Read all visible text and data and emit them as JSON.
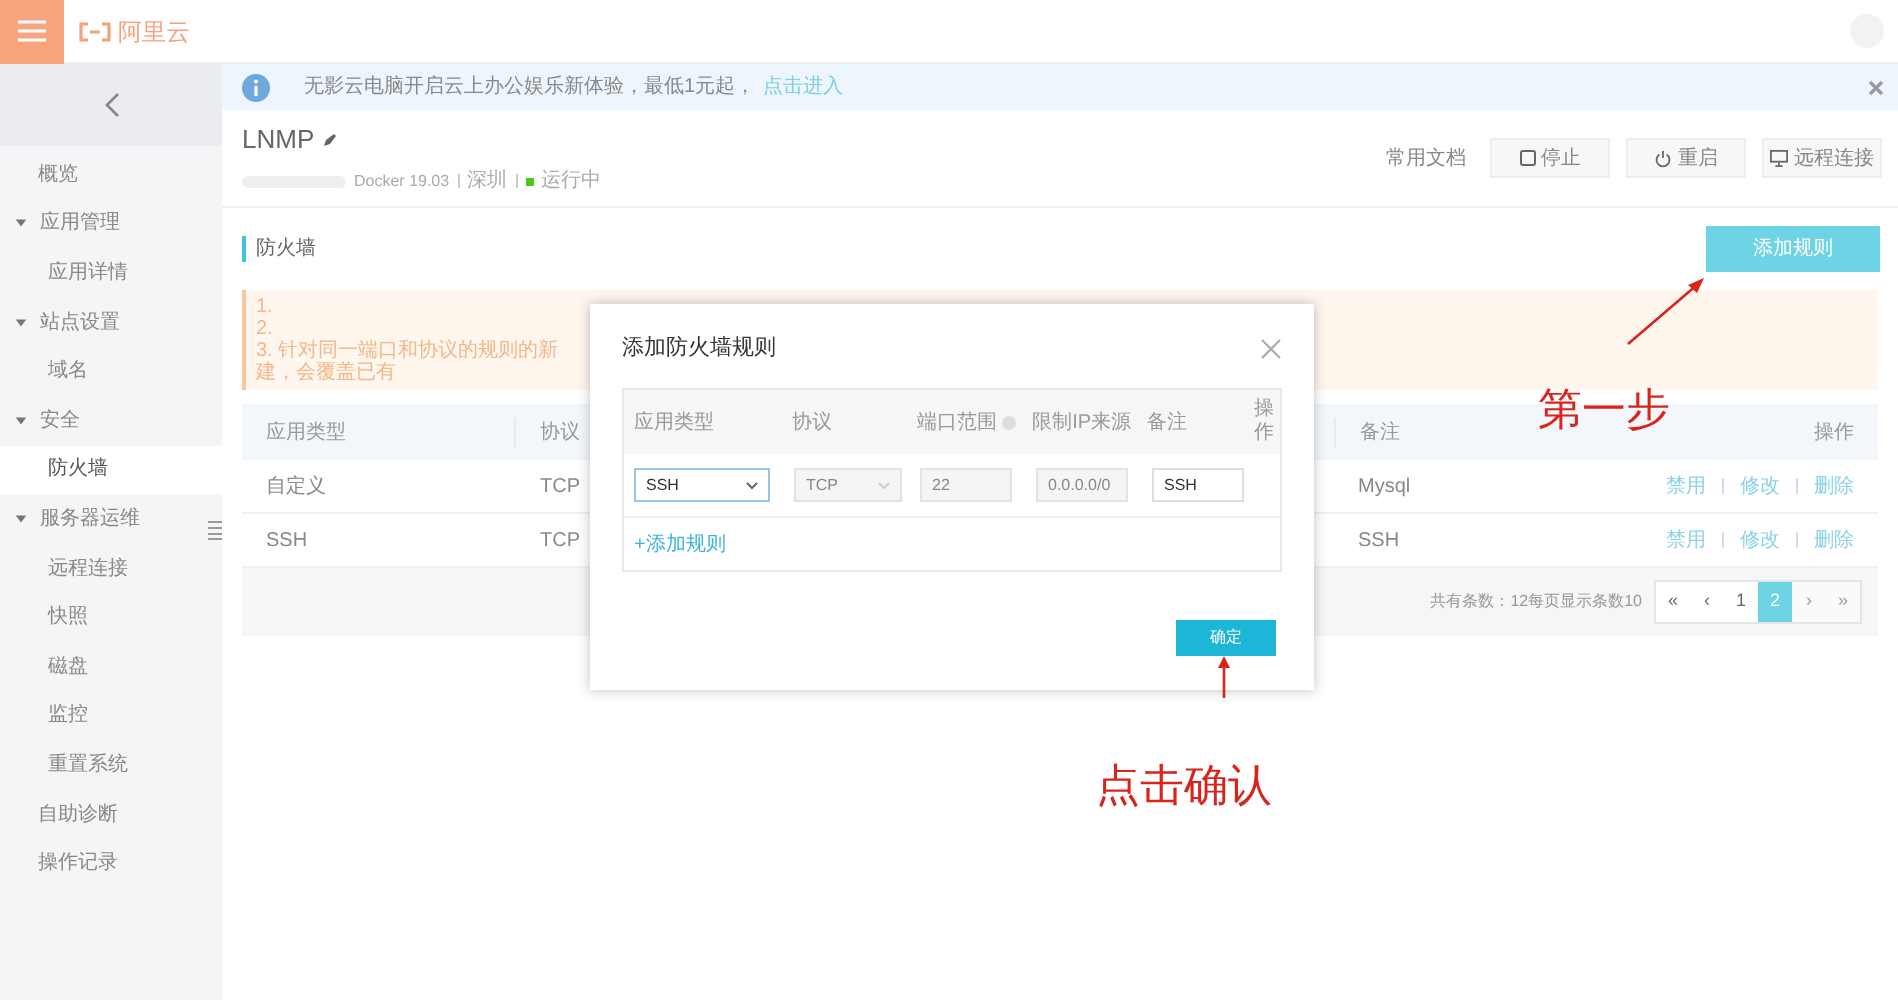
{
  "topbar": {
    "logo": "阿里云"
  },
  "banner": {
    "text": "无影云电脑开启云上办公娱乐新体验，最低1元起，",
    "link": "点击进入"
  },
  "sidebar": {
    "items": [
      {
        "label": "概览",
        "selected": false
      },
      {
        "label": "应用管理",
        "expanded": true,
        "selected": false,
        "children": [
          {
            "label": "应用详情",
            "selected": false
          }
        ]
      },
      {
        "label": "站点设置",
        "expanded": true,
        "selected": false,
        "children": [
          {
            "label": "域名",
            "selected": false
          }
        ]
      },
      {
        "label": "安全",
        "expanded": true,
        "selected": false,
        "children": [
          {
            "label": "防火墙",
            "selected": true
          }
        ]
      },
      {
        "label": "服务器运维",
        "expanded": true,
        "selected": false,
        "children": [
          {
            "label": "远程连接",
            "selected": false
          },
          {
            "label": "快照",
            "selected": false
          },
          {
            "label": "磁盘",
            "selected": false
          },
          {
            "label": "监控",
            "selected": false
          },
          {
            "label": "重置系统",
            "selected": false
          }
        ]
      },
      {
        "label": "自助诊断",
        "selected": false
      },
      {
        "label": "操作记录",
        "selected": false
      }
    ]
  },
  "instance": {
    "name": "LNMP",
    "image": "Docker 19.03",
    "region": "深圳",
    "status": "运行中",
    "running": true,
    "actions": [
      {
        "kind": "link",
        "label": "常用文档"
      },
      {
        "kind": "stop",
        "label": "停止"
      },
      {
        "kind": "restart",
        "label": "重启"
      },
      {
        "kind": "remote",
        "label": "远程连接"
      }
    ]
  },
  "firewall": {
    "title": "防火墙",
    "add_button": "添加规则",
    "notice": [
      "1.",
      "2.",
      "3. 针对同一端口和协议的规则的新建，会覆盖已有"
    ],
    "table": {
      "columns": [
        "应用类型",
        "协议",
        "备注",
        "操作"
      ],
      "rows": [
        {
          "cells": [
            "自定义",
            "TCP",
            "Mysql"
          ],
          "actions": [
            "禁用",
            "修改",
            "删除"
          ]
        },
        {
          "cells": [
            "SSH",
            "TCP",
            "SSH"
          ],
          "actions": [
            "禁用",
            "修改",
            "删除"
          ]
        }
      ]
    },
    "pagination": {
      "summary": "共有条数：12每页显示条数10",
      "pages": [
        {
          "label": "«",
          "selected": false,
          "disabled": false
        },
        {
          "label": "‹",
          "selected": false,
          "disabled": false
        },
        {
          "label": "1",
          "selected": false,
          "disabled": false
        },
        {
          "label": "2",
          "selected": true,
          "disabled": false
        },
        {
          "label": "›",
          "selected": false,
          "disabled": true
        },
        {
          "label": "»",
          "selected": false,
          "disabled": true
        }
      ]
    }
  },
  "dialog": {
    "title": "添加防火墙规则",
    "columns": [
      {
        "label": "应用类型",
        "help": false
      },
      {
        "label": "协议",
        "help": false
      },
      {
        "label": "端口范围",
        "help": true
      },
      {
        "label": "限制IP来源",
        "help": false
      },
      {
        "label": "备注",
        "help": false
      },
      {
        "label": "操作",
        "help": false
      }
    ],
    "fields": [
      {
        "kind": "select",
        "value": "SSH",
        "disabled": false
      },
      {
        "kind": "select",
        "value": "TCP",
        "disabled": true
      },
      {
        "kind": "input",
        "value": "22",
        "disabled": true
      },
      {
        "kind": "input",
        "value": "0.0.0.0/0",
        "disabled": true
      },
      {
        "kind": "input",
        "value": "SSH",
        "disabled": false
      }
    ],
    "add_link": "+添加规则",
    "confirm": "确定"
  },
  "annotations": [
    {
      "kind": "step",
      "text": "第一步"
    },
    {
      "kind": "confirm",
      "text": "点击确认"
    }
  ]
}
